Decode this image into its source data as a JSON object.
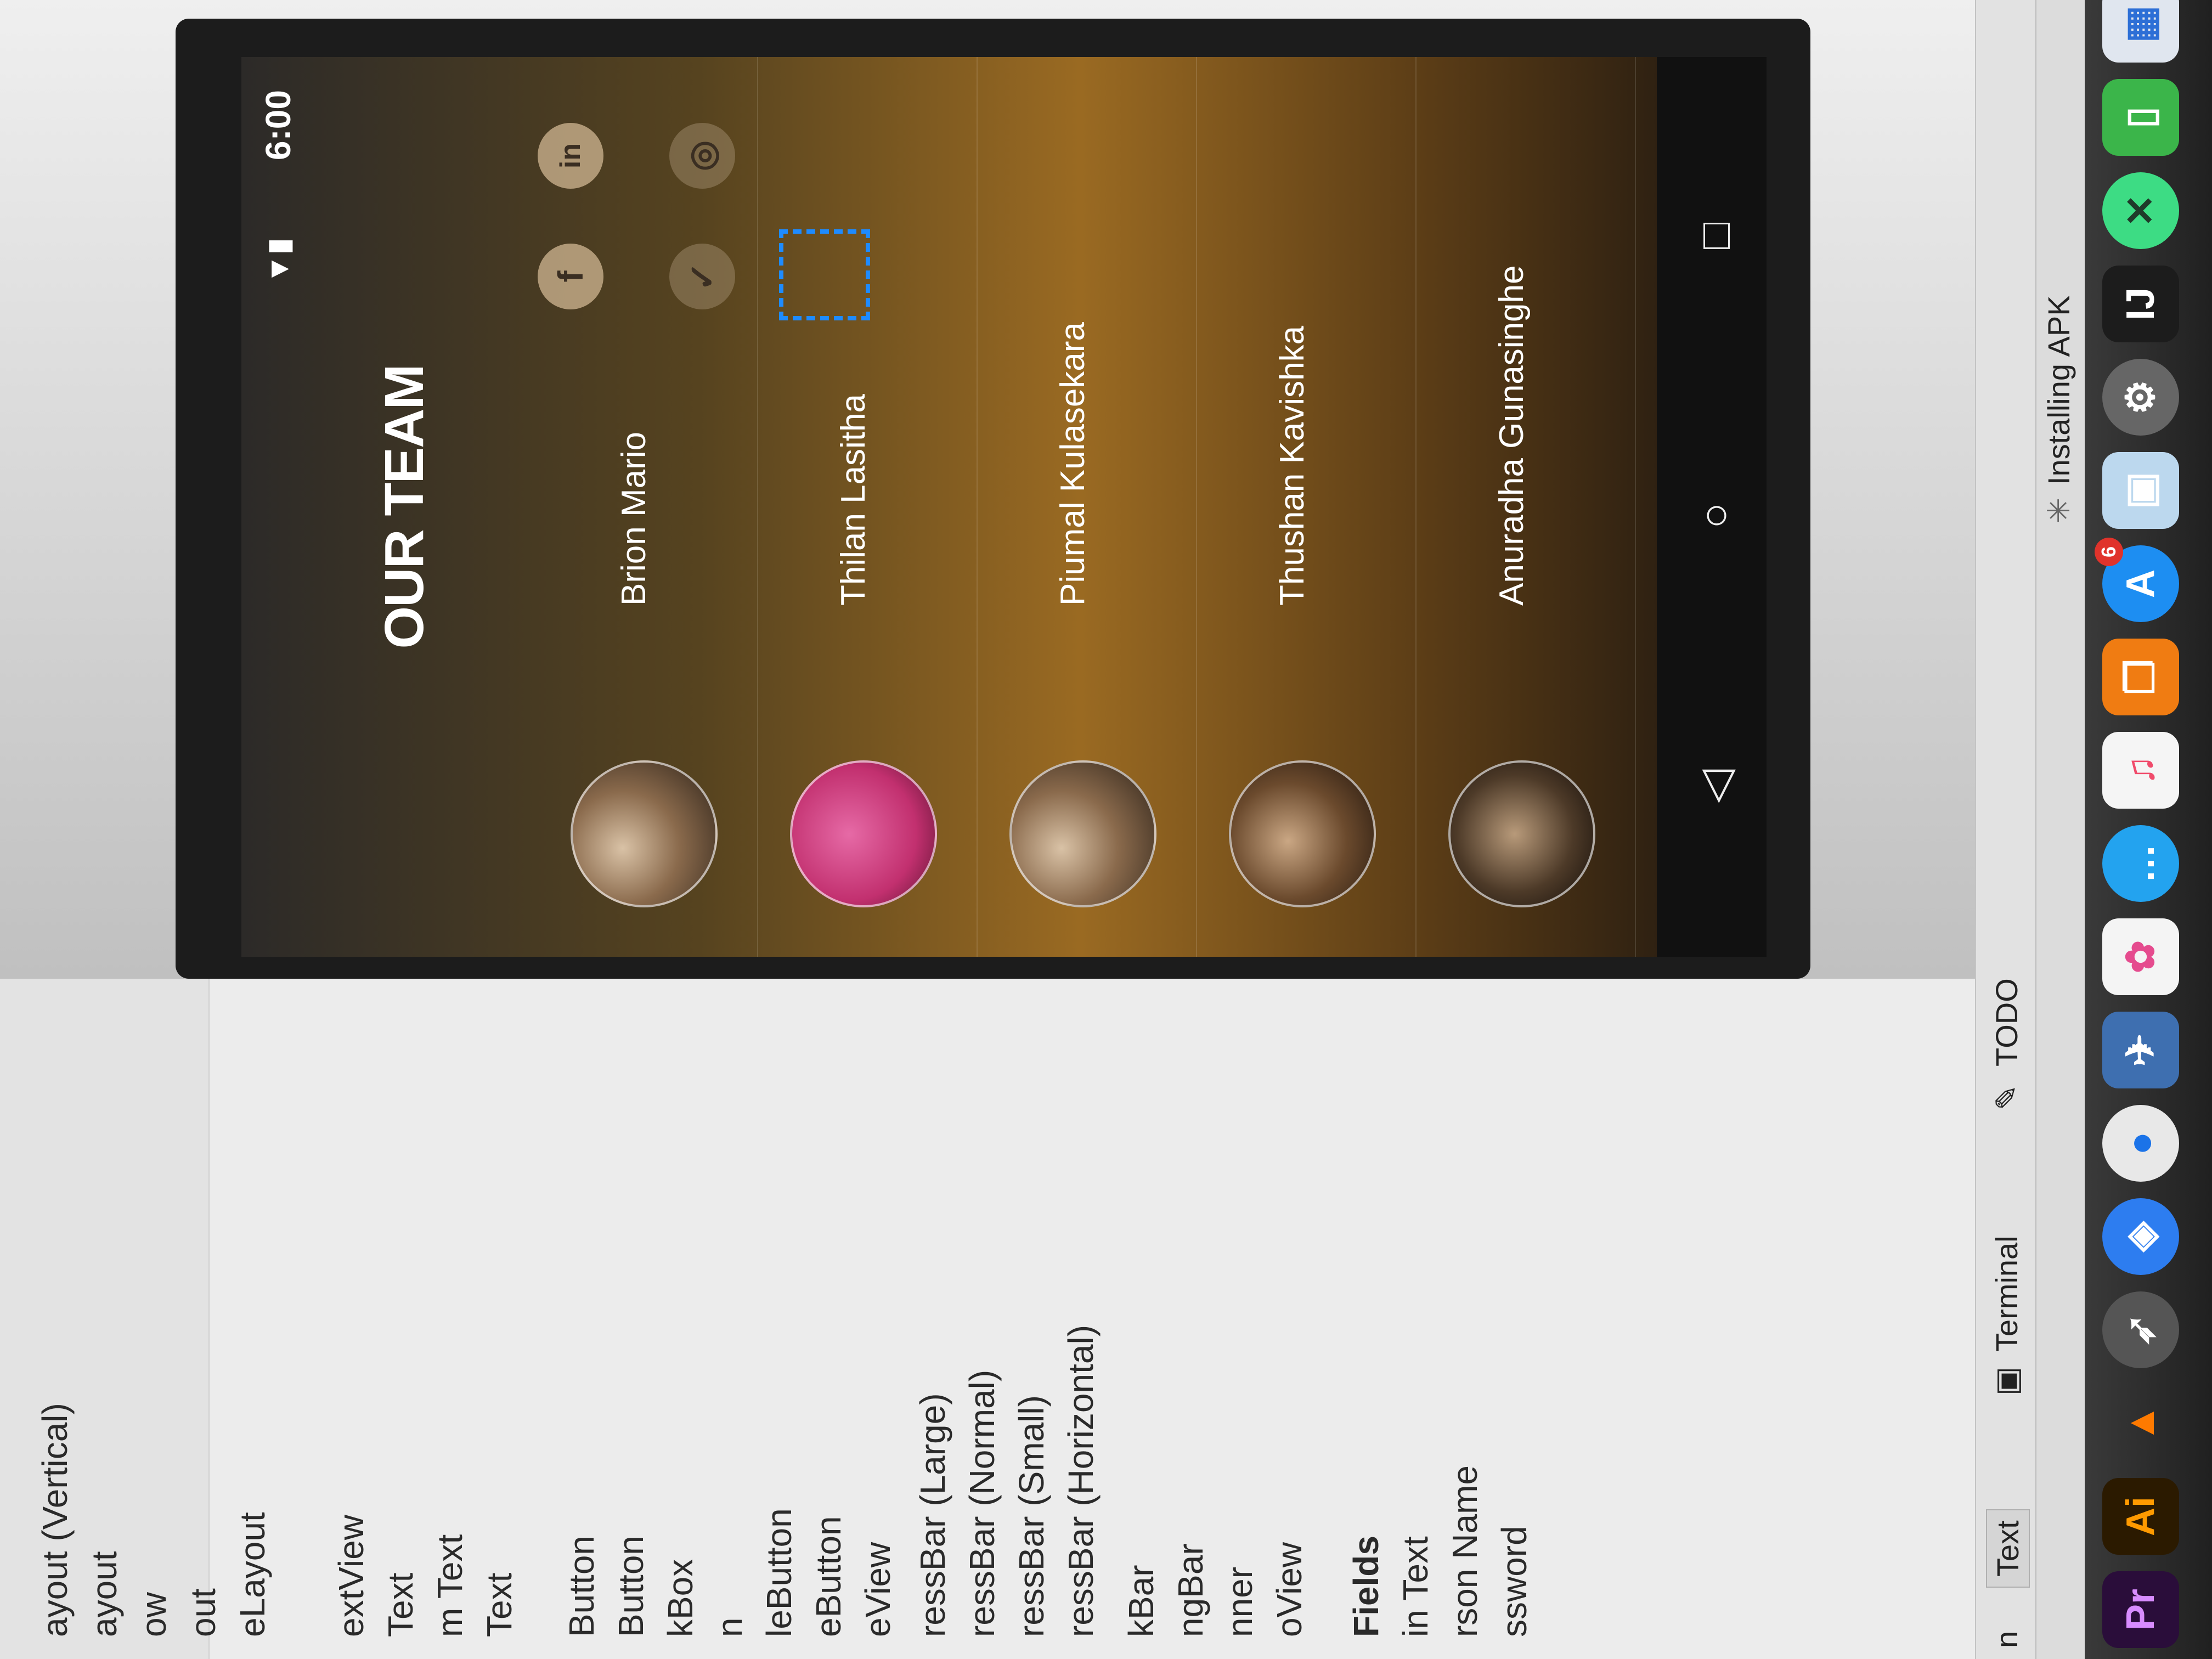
{
  "palette": {
    "items": [
      "ayout (Vertical)",
      "ayout",
      "ow",
      "out",
      "eLayout",
      "extView",
      "Text",
      "m Text",
      "Text",
      "Button",
      "Button",
      "kBox",
      "n",
      "leButton",
      "eButton",
      "eView",
      "ressBar (Large)",
      "ressBar (Normal)",
      "ressBar (Small)",
      "ressBar (Horizontal)",
      "kBar",
      "ngBar",
      "nner",
      "oView"
    ],
    "category": "Fields",
    "field_items": [
      "in Text",
      "rson Name",
      "ssword"
    ]
  },
  "phone": {
    "time": "6:00",
    "title": "OUR TEAM",
    "members": [
      {
        "name": "Brion Mario"
      },
      {
        "name": "Thilan Lasitha"
      },
      {
        "name": "Piumal Kulasekara"
      },
      {
        "name": "Thushan Kavishka"
      },
      {
        "name": "Anuradha Gunasinghe"
      }
    ],
    "social": {
      "facebook": "f",
      "linkedin": "in"
    },
    "nav": {
      "back": "◁",
      "home": "○",
      "recents": "□"
    }
  },
  "toolwindows": {
    "text_tab": "Text",
    "left_tab": "n",
    "terminal": "Terminal",
    "todo": "TODO"
  },
  "statusbar": {
    "message": "Installing APK"
  },
  "dock": {
    "premiere": "Pr",
    "illustrator": "Ai",
    "appstore_badge": "6"
  }
}
